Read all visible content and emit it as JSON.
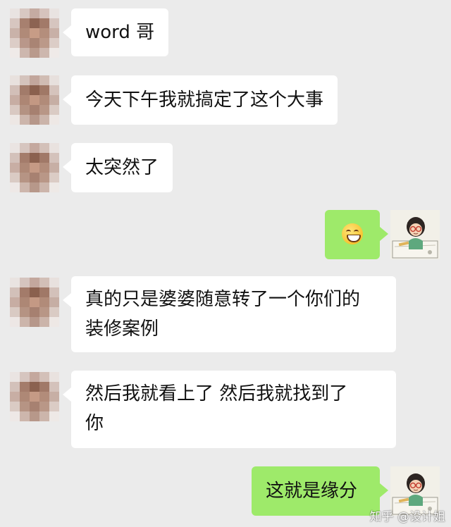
{
  "conversation": {
    "messages": [
      {
        "side": "in",
        "text": "word 哥"
      },
      {
        "side": "in",
        "text": "今天下午我就搞定了这个大事"
      },
      {
        "side": "in",
        "text": "太突然了"
      },
      {
        "side": "out",
        "emoji": "grinning-face-emoji"
      },
      {
        "side": "in",
        "lines": [
          "真的只是婆婆随意转了一个你们的",
          "装修案例"
        ]
      },
      {
        "side": "in",
        "lines": [
          "然后我就看上了  然后我就找到了",
          "你"
        ]
      },
      {
        "side": "out",
        "text": "这就是缘分"
      }
    ]
  },
  "colors": {
    "background": "#ebebeb",
    "incoming_bubble": "#ffffff",
    "outgoing_bubble": "#9eea6a"
  },
  "watermark": {
    "text": "知乎 @设计姐"
  }
}
